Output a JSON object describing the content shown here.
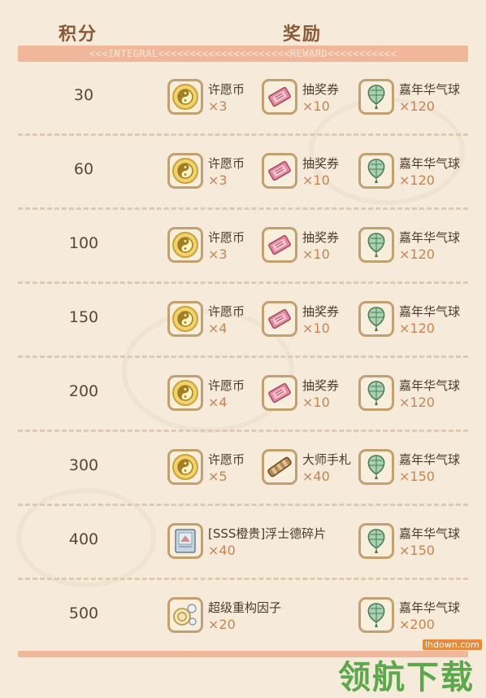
{
  "header": {
    "score_title": "积分",
    "reward_title": "奖励",
    "band_text": "<<<INTEGRAL<<<<<<<<<<<<<<<<<<<<<REWARD<<<<<<<<<<<"
  },
  "rows": [
    {
      "score": "30",
      "items": [
        {
          "icon": "yin-yang-coin-icon",
          "name": "许愿币",
          "qty": "×3"
        },
        {
          "icon": "ticket-icon",
          "name": "抽奖券",
          "qty": "×10"
        },
        {
          "icon": "balloon-icon",
          "name": "嘉年华气球",
          "qty": "×120"
        }
      ]
    },
    {
      "score": "60",
      "items": [
        {
          "icon": "yin-yang-coin-icon",
          "name": "许愿币",
          "qty": "×3"
        },
        {
          "icon": "ticket-icon",
          "name": "抽奖券",
          "qty": "×10"
        },
        {
          "icon": "balloon-icon",
          "name": "嘉年华气球",
          "qty": "×120"
        }
      ]
    },
    {
      "score": "100",
      "items": [
        {
          "icon": "yin-yang-coin-icon",
          "name": "许愿币",
          "qty": "×3"
        },
        {
          "icon": "ticket-icon",
          "name": "抽奖券",
          "qty": "×10"
        },
        {
          "icon": "balloon-icon",
          "name": "嘉年华气球",
          "qty": "×120"
        }
      ]
    },
    {
      "score": "150",
      "items": [
        {
          "icon": "yin-yang-coin-icon",
          "name": "许愿币",
          "qty": "×4"
        },
        {
          "icon": "ticket-icon",
          "name": "抽奖券",
          "qty": "×10"
        },
        {
          "icon": "balloon-icon",
          "name": "嘉年华气球",
          "qty": "×120"
        }
      ]
    },
    {
      "score": "200",
      "items": [
        {
          "icon": "yin-yang-coin-icon",
          "name": "许愿币",
          "qty": "×4"
        },
        {
          "icon": "ticket-icon",
          "name": "抽奖券",
          "qty": "×10"
        },
        {
          "icon": "balloon-icon",
          "name": "嘉年华气球",
          "qty": "×120"
        }
      ]
    },
    {
      "score": "300",
      "items": [
        {
          "icon": "yin-yang-coin-icon",
          "name": "许愿币",
          "qty": "×5"
        },
        {
          "icon": "scroll-icon",
          "name": "大师手札",
          "qty": "×40"
        },
        {
          "icon": "balloon-icon",
          "name": "嘉年华气球",
          "qty": "×150"
        }
      ]
    },
    {
      "score": "400",
      "items": [
        {
          "icon": "card-fragment-icon",
          "name": "[SSS橙贵]浮士德碎片",
          "qty": "×40"
        },
        {
          "icon": "balloon-icon",
          "name": "嘉年华气球",
          "qty": "×150"
        }
      ]
    },
    {
      "score": "500",
      "items": [
        {
          "icon": "gear-factor-icon",
          "name": "超级重构因子",
          "qty": "×20"
        },
        {
          "icon": "balloon-icon",
          "name": "嘉年华气球",
          "qty": "×200"
        }
      ]
    }
  ],
  "watermark": {
    "text": "领航下载",
    "url": "lhdown.com"
  },
  "colors": {
    "background": "#f6eadb",
    "band": "#f0b79b",
    "qty": "#c9834f",
    "title": "#8a5a35"
  }
}
